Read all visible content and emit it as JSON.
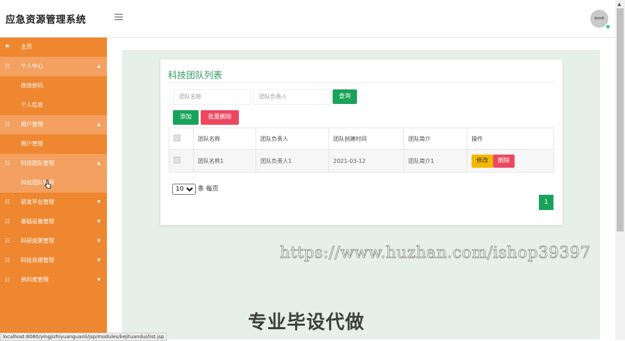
{
  "app": {
    "title": "应急资源管理系统",
    "avatar_text": "Kohl6"
  },
  "sidebar": {
    "items": [
      {
        "label": "主页",
        "icon": "flag-icon",
        "has_caret": false
      },
      {
        "label": "个人中心",
        "icon": "grid-icon",
        "has_caret": true,
        "children": [
          "修改密码",
          "个人信息"
        ]
      },
      {
        "label": "用户管理",
        "icon": "grid-icon",
        "has_caret": true,
        "children": [
          "用户管理"
        ]
      },
      {
        "label": "科技团队管理",
        "icon": "grid-icon",
        "has_caret": true,
        "children": [
          "科技团队管理"
        ]
      },
      {
        "label": "研发平台管理",
        "icon": "grid-icon",
        "has_caret": true
      },
      {
        "label": "基础设备管理",
        "icon": "grid-icon",
        "has_caret": true
      },
      {
        "label": "科研成果管理",
        "icon": "grid-icon",
        "has_caret": true
      },
      {
        "label": "科技资源管理",
        "icon": "grid-icon",
        "has_caret": true
      },
      {
        "label": "资料库管理",
        "icon": "grid-icon",
        "has_caret": true
      }
    ]
  },
  "main": {
    "title": "科技团队列表",
    "search": {
      "name_placeholder": "团队名称",
      "leader_placeholder": "团队负责人",
      "query_label": "查询"
    },
    "actions": {
      "add_label": "添加",
      "batch_delete_label": "批量删除"
    },
    "table": {
      "headers": [
        "",
        "团队名称",
        "团队负责人",
        "团队创建时间",
        "团队简介",
        "操作"
      ],
      "rows": [
        {
          "name": "团队名称1",
          "leader": "团队负责人1",
          "created": "2021-03-12",
          "intro": "团队简介1",
          "edit_label": "修改",
          "delete_label": "删除"
        }
      ]
    },
    "pager": {
      "page_size": "10",
      "page_size_suffix": "条 每页",
      "current_page": "1"
    }
  },
  "watermark": {
    "url": "https://www.huzhan.com/ishop39397",
    "text": "专业毕设代做"
  },
  "status_url": "localhost:8080/yingjizhiyuanguanli/jsp/modules/kejituandui/list.jsp",
  "colors": {
    "sidebar": "#ef8730",
    "sidebar_open": "#f3a060",
    "accent_green": "#19a35a",
    "danger": "#ee4760",
    "warning": "#f5b800",
    "title_green": "#2e9e5b"
  }
}
